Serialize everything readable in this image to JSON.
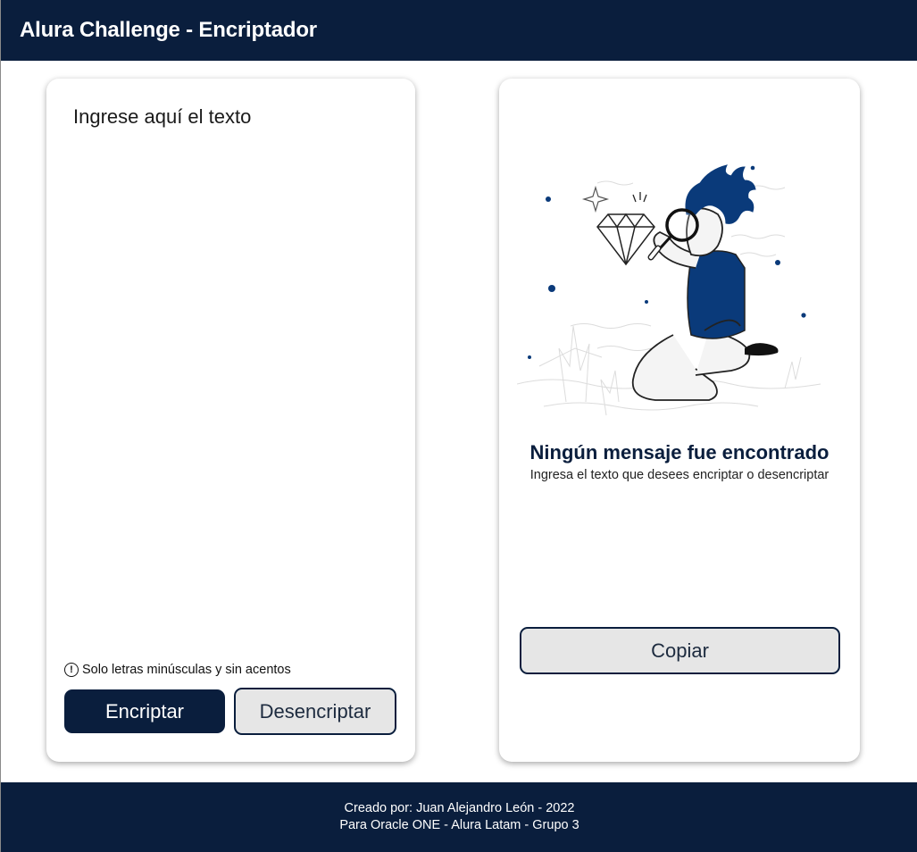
{
  "header": {
    "title": "Alura Challenge - Encriptador"
  },
  "input": {
    "placeholder": "Ingrese aquí el texto",
    "value": ""
  },
  "hint": {
    "icon": "info-circle-icon",
    "text": "Solo letras minúsculas y sin acentos"
  },
  "buttons": {
    "encrypt_label": "Encriptar",
    "decrypt_label": "Desencriptar",
    "copy_label": "Copiar"
  },
  "output": {
    "illustration": "person-with-magnifying-glass-illustration",
    "empty_title": "Ningún mensaje fue encontrado",
    "empty_subtitle": "Ingresa el texto que desees encriptar o desencriptar"
  },
  "footer": {
    "line1": "Creado por: Juan Alejandro León - 2022",
    "line2": "Para Oracle ONE - Alura Latam - Grupo 3"
  },
  "colors": {
    "primary": "#0a1e3d",
    "secondary_button_bg": "#e6e6e6",
    "illustration_accent": "#0a3a7a"
  }
}
